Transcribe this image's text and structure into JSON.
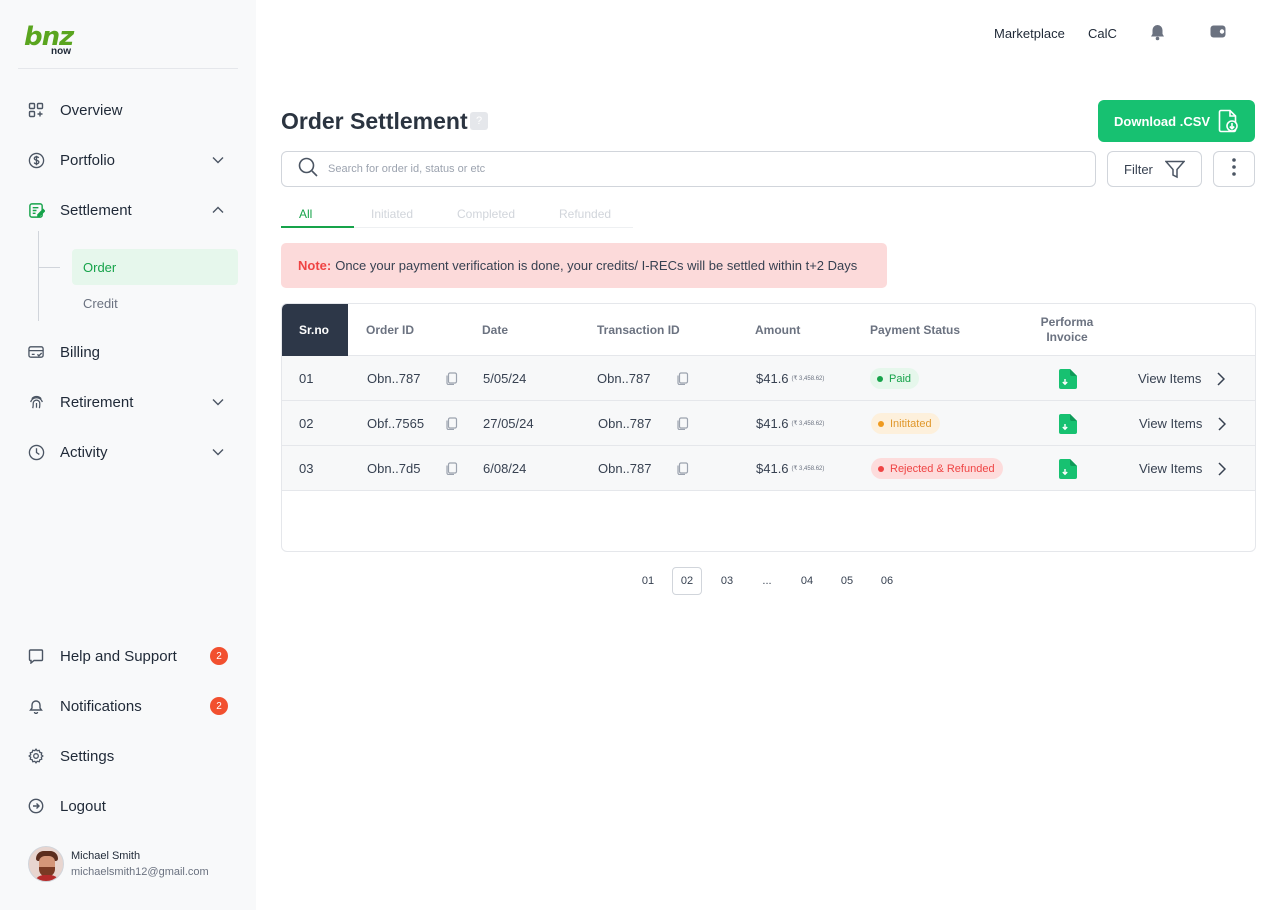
{
  "brand": {
    "logo_main": "bnz",
    "logo_sub": "now"
  },
  "header": {
    "links": [
      "Marketplace",
      "CalC"
    ],
    "icons": [
      "bell-icon",
      "wallet-icon"
    ]
  },
  "sidebar": {
    "items": [
      {
        "label": "Overview",
        "icon": "grid-icon"
      },
      {
        "label": "Portfolio",
        "icon": "dollar-circle-icon"
      },
      {
        "label": "Settlement",
        "icon": "edit-note-icon"
      },
      {
        "label": "Billing",
        "icon": "card-icon"
      },
      {
        "label": "Retirement",
        "icon": "fingerprint-icon"
      },
      {
        "label": "Activity",
        "icon": "clock-icon"
      }
    ],
    "subitems": [
      "Order",
      "Credit"
    ],
    "bottom": [
      {
        "label": "Help and Support",
        "icon": "chat-icon",
        "badge": "2"
      },
      {
        "label": "Notifications",
        "icon": "bell-icon",
        "badge": "2"
      },
      {
        "label": "Settings",
        "icon": "gear-icon"
      },
      {
        "label": "Logout",
        "icon": "logout-icon"
      }
    ],
    "user": {
      "name": "Michael Smith",
      "email": "michaelsmith12@gmail.com"
    }
  },
  "page": {
    "title": "Order Settlement",
    "help": "?",
    "download_label": "Download .CSV",
    "search_placeholder": "Search for order id, status or etc",
    "filter_label": "Filter",
    "tabs": [
      "All",
      "Initiated",
      "Completed",
      "Refunded"
    ],
    "note_label": "Note:",
    "note_text": "Once your payment verification is done, your credits/ I-RECs will be settled within t+2 Days"
  },
  "table": {
    "headers": {
      "srno": "Sr.no",
      "order_id": "Order ID",
      "date": "Date",
      "txn_id": "Transaction ID",
      "amount": "Amount",
      "status": "Payment Status",
      "invoice_1": "Performa",
      "invoice_2": "Invoice"
    },
    "rows": [
      {
        "srno": "01",
        "order_id": "Obn..787",
        "date": "5/05/24",
        "txn_id": "Obn..787",
        "amount": "$41.6",
        "amount_sub": "(₹ 3,458.62)",
        "status": "Paid",
        "action": "View Items"
      },
      {
        "srno": "02",
        "order_id": "Obf..7565",
        "date": "27/05/24",
        "txn_id": "Obn..787",
        "amount": "$41.6",
        "amount_sub": "(₹ 3,458.62)",
        "status": "Inititated",
        "action": "View Items"
      },
      {
        "srno": "03",
        "order_id": "Obn..7d5",
        "date": "6/08/24",
        "txn_id": "Obn..787",
        "amount": "$41.6",
        "amount_sub": "(₹ 3,458.62)",
        "status": "Rejected & Refunded",
        "action": "View Items"
      }
    ]
  },
  "pagination": [
    "01",
    "02",
    "03",
    "...",
    "04",
    "05",
    "06"
  ],
  "colors": {
    "accent": "#17c171",
    "active_text": "#16a34a",
    "header_dark": "#2d3748",
    "note_bg": "#fcdada"
  }
}
